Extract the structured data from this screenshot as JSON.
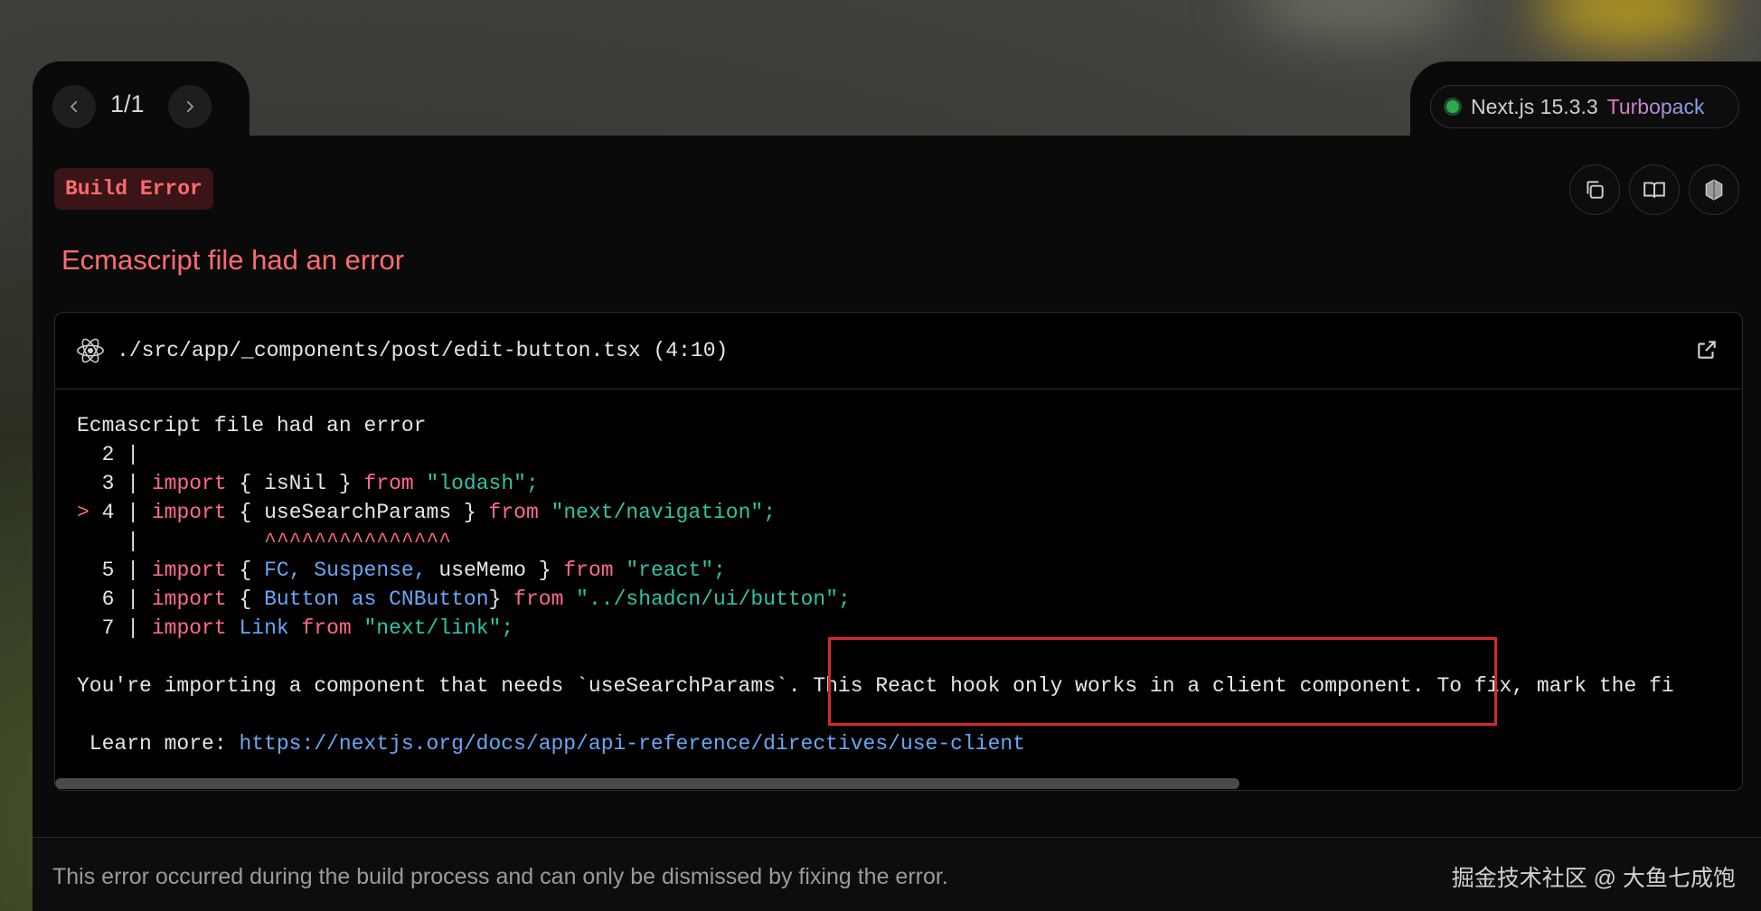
{
  "nav": {
    "pager": "1/1",
    "prev_icon": "chevron-left-icon",
    "next_icon": "chevron-right-icon"
  },
  "version": {
    "label": "Next.js 15.3.3",
    "bundler": "Turbopack",
    "status_color": "#2fa84f"
  },
  "badge": "Build Error",
  "toolbar": {
    "copy_icon": "copy-icon",
    "docs_icon": "book-icon",
    "feedback_icon": "hexagon-icon"
  },
  "title": "Ecmascript file had an error",
  "code": {
    "file_path": "./src/app/_components/post/edit-button.tsx (4:10)",
    "heading": "Ecmascript file had an error",
    "lines": [
      {
        "marker": " ",
        "num": "2",
        "text": ""
      },
      {
        "marker": " ",
        "num": "3",
        "kw1": "import",
        "p1": " { isNil } ",
        "kw2": "from",
        "str": " \"lodash\";"
      },
      {
        "marker": ">",
        "num": "4",
        "kw1": "import",
        "p1": " { useSearchParams } ",
        "kw2": "from",
        "str": " \"next/navigation\";"
      },
      {
        "caret": "^^^^^^^^^^^^^^^"
      },
      {
        "marker": " ",
        "num": "5",
        "kw1": "import",
        "p1": " { ",
        "id1": "FC, Suspense,",
        "p2": " useMemo } ",
        "kw2": "from",
        "str": " \"react\";"
      },
      {
        "marker": " ",
        "num": "6",
        "kw1": "import",
        "p1": " { ",
        "id1": "Button as CNButton",
        "p2": "} ",
        "kw2": "from",
        "str": " \"../shadcn/ui/button\";"
      },
      {
        "marker": " ",
        "num": "7",
        "kw1": "import",
        "id1": " Link",
        "kw2": " from",
        "str": " \"next/link\";"
      }
    ],
    "message": "You're importing a component that needs `useSearchParams`. This React hook only works in a client component. To fix, mark the fi",
    "learn_more_label": " Learn more: ",
    "learn_more_url": "https://nextjs.org/docs/app/api-reference/directives/use-client"
  },
  "footer": {
    "text": "This error occurred during the build process and can only be dismissed by fixing the error.",
    "watermark": "掘金技术社区 @ 大鱼七成饱"
  }
}
